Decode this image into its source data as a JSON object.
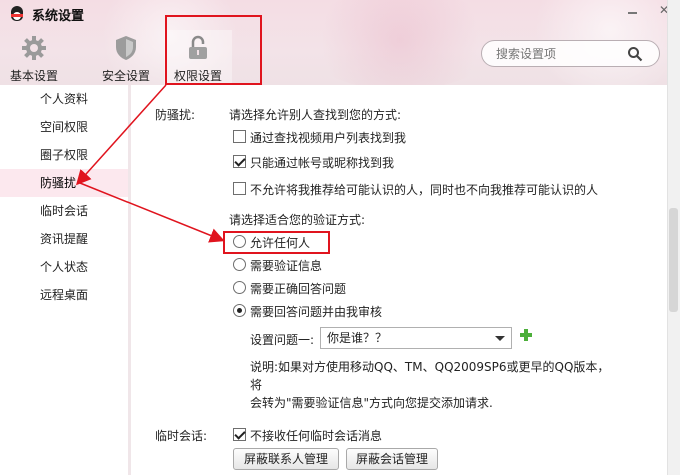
{
  "window": {
    "title": "系统设置",
    "min_label": "",
    "close_label": "✕"
  },
  "toolbar": {
    "items": [
      {
        "label": "基本设置",
        "icon": "gear-icon"
      },
      {
        "label": "安全设置",
        "icon": "shield-icon"
      },
      {
        "label": "权限设置",
        "icon": "lock-icon"
      }
    ]
  },
  "search": {
    "placeholder": "搜索设置项",
    "icon": "search-icon"
  },
  "sidebar": {
    "items": [
      {
        "label": "个人资料"
      },
      {
        "label": "空间权限"
      },
      {
        "label": "圈子权限"
      },
      {
        "label": "防骚扰",
        "active": true
      },
      {
        "label": "临时会话"
      },
      {
        "label": "资讯提醒"
      },
      {
        "label": "个人状态"
      },
      {
        "label": "远程桌面"
      }
    ]
  },
  "harass": {
    "section_label": "防骚扰:",
    "find_prompt": "请选择允许别人查找到您的方式:",
    "find_options": [
      {
        "label": "通过查找视频用户列表找到我",
        "checked": false
      },
      {
        "label": "只能通过帐号或昵称找到我",
        "checked": true
      },
      {
        "label": "不允许将我推荐给可能认识的人，同时也不向我推荐可能认识的人",
        "checked": false
      }
    ],
    "verify_prompt": "请选择适合您的验证方式:",
    "verify_options": [
      {
        "label": "允许任何人",
        "checked": false
      },
      {
        "label": "需要验证信息",
        "checked": false
      },
      {
        "label": "需要正确回答问题",
        "checked": false
      },
      {
        "label": "需要回答问题并由我审核",
        "checked": true
      }
    ],
    "question_label": "设置问题一:",
    "question_value": "你是谁？？",
    "note_line1": "说明:如果对方使用移动QQ、TM、QQ2009SP6或更早的QQ版本，将",
    "note_line2": "会转为\"需要验证信息\"方式向您提交添加请求."
  },
  "temp_chat": {
    "section_label": "临时会话:",
    "option_label": "不接收任何临时会话消息",
    "option_checked": true,
    "block_contacts_button": "屏蔽联系人管理",
    "block_sessions_button": "屏蔽会话管理"
  },
  "annotation_color": "#e0141e"
}
